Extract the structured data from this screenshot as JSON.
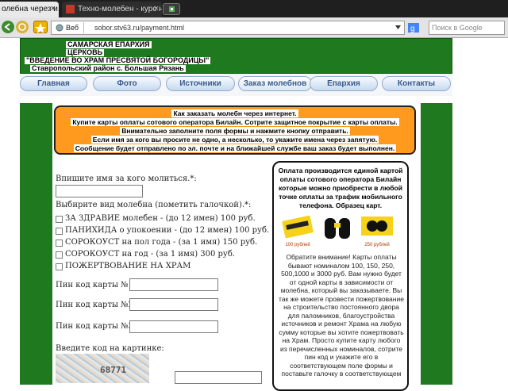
{
  "browser": {
    "tabs": [
      {
        "label": "олебна через и...",
        "close": "×"
      },
      {
        "label": "Техно-молебен - курс н...",
        "close": "×"
      }
    ],
    "address": {
      "web_label": "Веб",
      "url": "sobor.stv63.ru/payment.html"
    },
    "search": {
      "placeholder": "Поиск в Google"
    }
  },
  "header": {
    "line1": "САМАРСКАЯ ЕПАРХИЯ",
    "line2": "ЦЕРКОВЬ",
    "line3": "\"ВВЕДЕНИЕ ВО ХРАМ ПРЕСВЯТОЙ БОГОРОДИЦЫ\"",
    "line4": "Ставропольский район с. Большая Рязань"
  },
  "nav": {
    "items": [
      "Главная",
      "Фото",
      "Источники",
      "Заказ молебнов",
      "Епархия",
      "Контакты"
    ],
    "active_index": 3
  },
  "notice": {
    "lines": [
      "Как заказать молебн через интернет.",
      "Купите карты оплаты сотового оператора Билайн. Сотрите защитное покрытие с карты оплаты.",
      "Внимательно заполните поля формы и нажмите кнопку отправить.",
      "Если имя за кого вы просите не одно, а несколько, то укажите имена через запятую.",
      "Сообщение будет отправлено по эл. почте и на ближайшей службе ваш заказ будет выполнен."
    ],
    "color": "#ff9a1f"
  },
  "form": {
    "name_label": "Впишите имя за кого молиться.*:",
    "type_label": "Выбирите вид молебна (пометить галочкой).*:",
    "options": [
      "ЗА ЗДРАВИЕ молебен - (до 12 имен) 100 руб.",
      "ПАНИХИДА о упокоении - (до 12 имен) 100 руб.",
      "СОРОКОУСТ на пол года - (за 1 имя) 150 руб.",
      "СОРОКОУСТ на год - (за 1 имя) 300 руб.",
      "ПОЖЕРТВОВАНИЕ НА ХРАМ"
    ],
    "pin1_label": "Пин код карты №1:",
    "pin2_label": "Пин код карты №2:",
    "pin3_label": "Пин код карты №3:",
    "captcha_label": "Введите код на картинке:",
    "captcha_code": "68771"
  },
  "info": {
    "head": "Оплата производится единой картой оплаты сотового оператора Билайн которые можно приобрести в любой точке оплаты за трафик мобильного телефона. Образец карт.",
    "card1": "100 рублей",
    "card2": "250 рублей",
    "body": "Обратите внимание! Карты оплаты бывают номиналом 100, 150, 250, 500,1000 и 3000 руб. Вам нужно будет от одной карты в зависимости от молебна, который вы заказываете. Вы так же можете провести пожертвование на строительство постоянного двора для паломников, благоустройства источников и ремонт Храма на любую сумму которые вы хотите пожертвовать на Храм. Просто купите карту любого из перечисленных номиналов, сотрите пин код и укажите его в соответствующем поле формы и поставьте галочку в соответствующем"
  },
  "colors": {
    "green": "#1f7a1f",
    "orange": "#ff9a1f"
  }
}
